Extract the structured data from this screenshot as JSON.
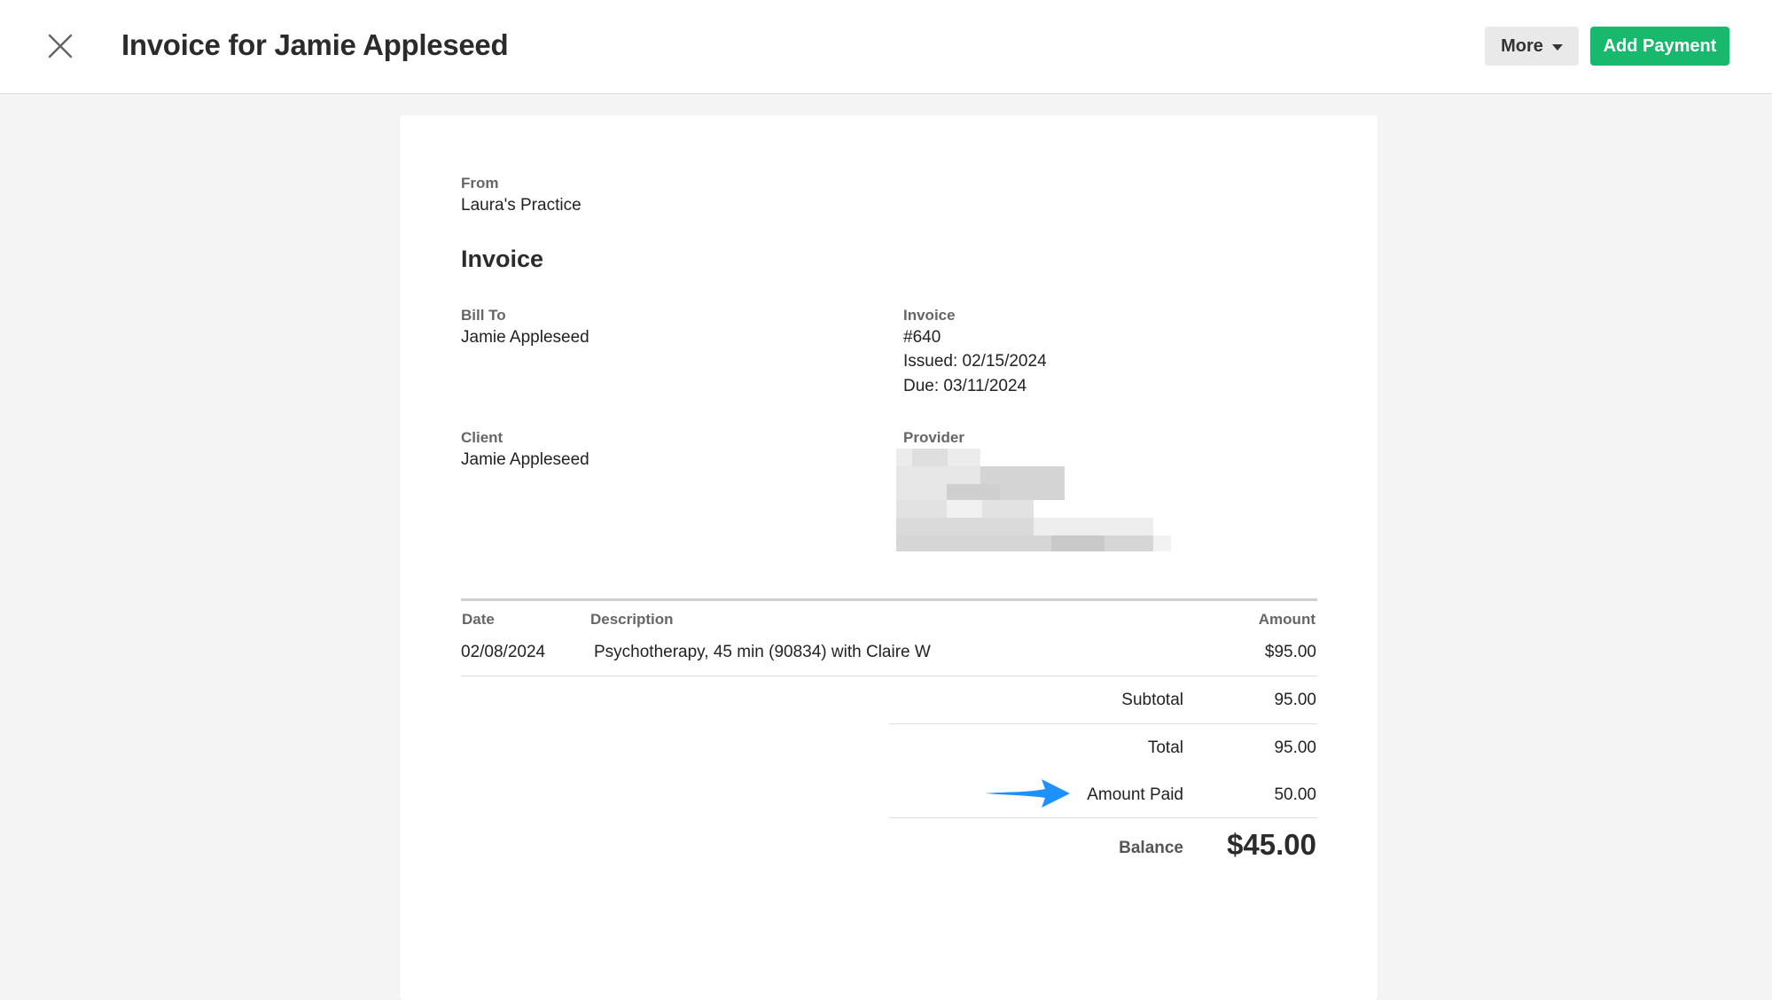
{
  "header": {
    "title": "Invoice for Jamie Appleseed",
    "more_label": "More",
    "add_payment_label": "Add Payment"
  },
  "invoice": {
    "from_label": "From",
    "from_value": "Laura's Practice",
    "heading": "Invoice",
    "bill_to_label": "Bill To",
    "bill_to_value": "Jamie Appleseed",
    "invoice_label": "Invoice",
    "number": "#640",
    "issued": "Issued: 02/15/2024",
    "due": "Due: 03/11/2024",
    "client_label": "Client",
    "client_value": "Jamie Appleseed",
    "provider_label": "Provider"
  },
  "table": {
    "columns": [
      "Date",
      "Description",
      "Amount"
    ],
    "rows": [
      [
        "02/08/2024",
        "Psychotherapy, 45 min (90834) with Claire W",
        "$95.00"
      ]
    ]
  },
  "summary": {
    "subtotal_label": "Subtotal",
    "subtotal_value": "95.00",
    "total_label": "Total",
    "total_value": "95.00",
    "paid_label": "Amount Paid",
    "paid_value": "50.00",
    "balance_label": "Balance",
    "balance_value": "$45.00"
  },
  "colors": {
    "accent_green": "#18b96d",
    "arrow_blue": "#1e90ff"
  },
  "icons": {
    "close": "close-icon",
    "caret": "chevron-down-icon",
    "annotation": "arrow-right-icon"
  }
}
